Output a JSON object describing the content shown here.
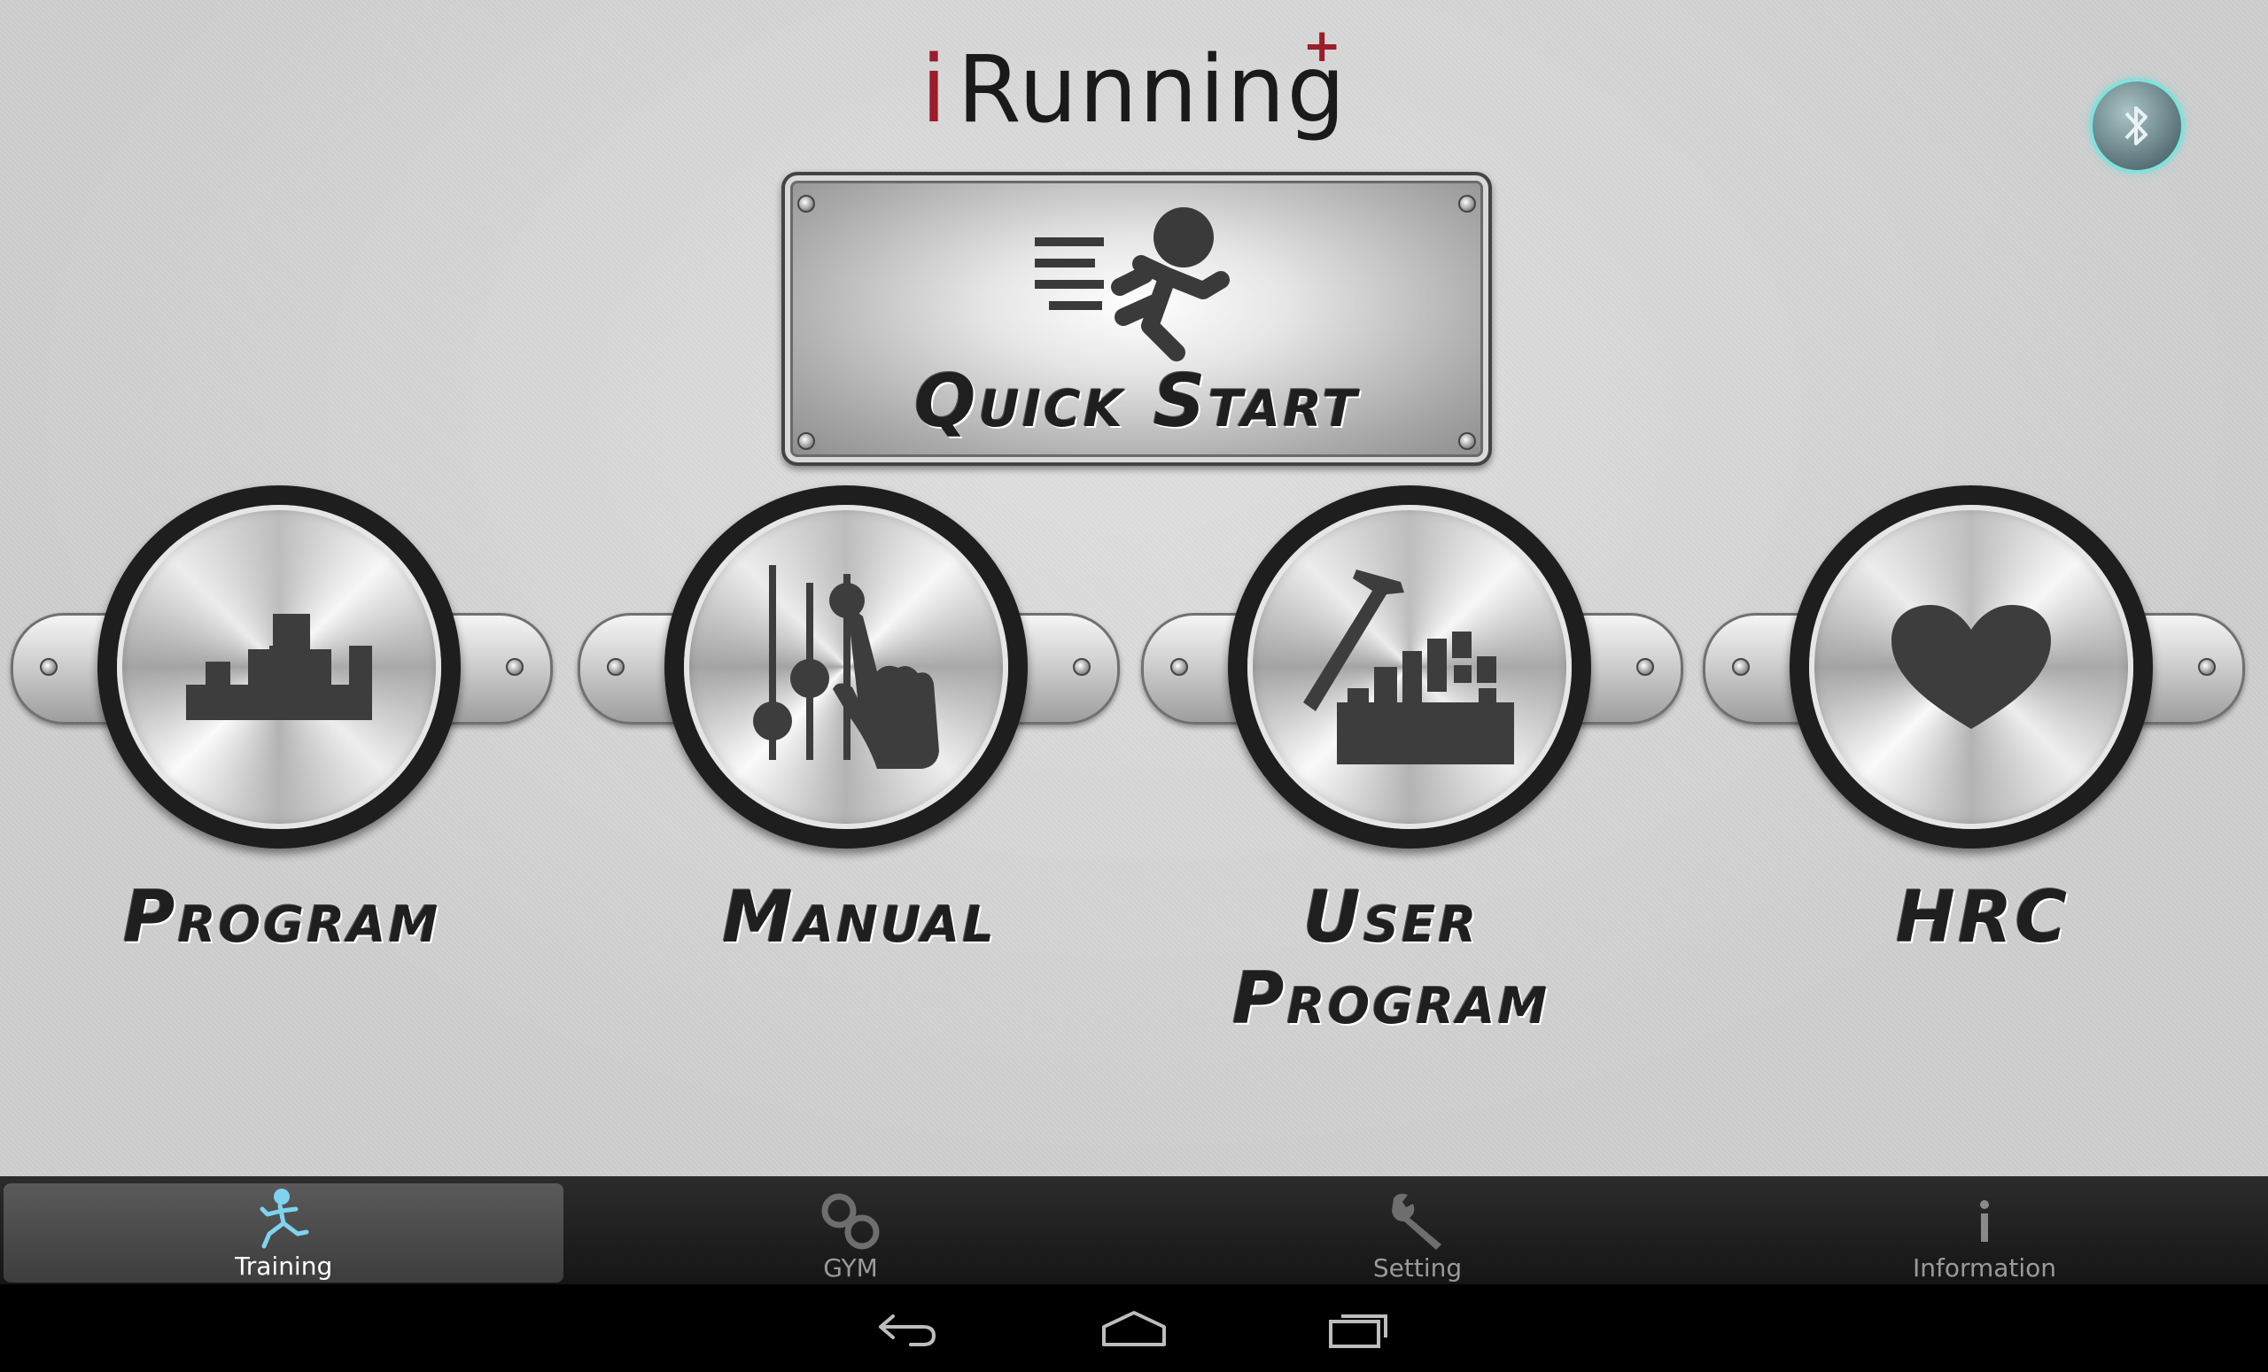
{
  "app": {
    "logo_i": "i",
    "logo_text": "Running",
    "logo_plus": "+"
  },
  "header": {
    "bluetooth_icon": "bluetooth-icon"
  },
  "quick_start": {
    "label": "Quick Start",
    "icon": "runner-icon"
  },
  "modes": [
    {
      "label": "Program",
      "icon": "bar-profile-icon"
    },
    {
      "label": "Manual",
      "icon": "slider-hand-icon"
    },
    {
      "label_line1": "User",
      "label_line2": "Program",
      "icon": "hammer-blocks-icon"
    },
    {
      "label": "HRC",
      "icon": "heart-icon"
    }
  ],
  "tabs": [
    {
      "label": "Training",
      "icon": "runner-icon",
      "active": true
    },
    {
      "label": "GYM",
      "icon": "rings-icon",
      "active": false
    },
    {
      "label": "Setting",
      "icon": "wrench-icon",
      "active": false
    },
    {
      "label": "Information",
      "icon": "info-icon",
      "active": false
    }
  ],
  "colors": {
    "logo_accent": "#9b1c2a",
    "active_tab_icon": "#7fd3f0",
    "bluetooth_glow": "#7fe3dd"
  }
}
